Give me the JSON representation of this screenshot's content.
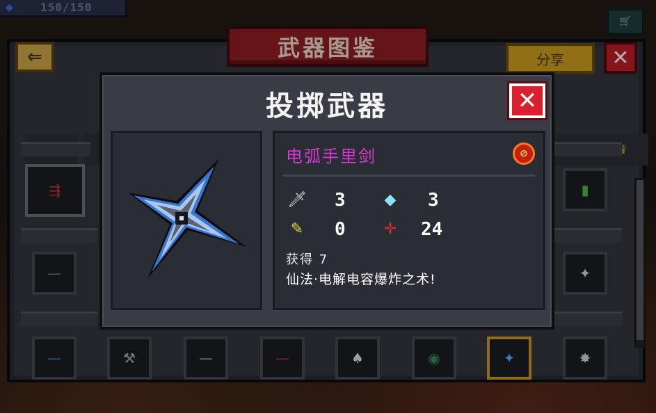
{
  "hud": {
    "energy_text": "150/150",
    "energy_icon": "diamond-icon",
    "cart_icon": "cart-icon"
  },
  "codex": {
    "title": "武器图鉴",
    "back_icon": "back-arrow-icon",
    "share_label": "分享",
    "close_icon": "close-icon"
  },
  "modal": {
    "title": "投掷武器",
    "close_icon": "close-icon",
    "weapon": {
      "name": "电弧手里剑",
      "name_color": "#d23ad2",
      "icon": "shuriken-icon",
      "unsellable_icon": "no-sell-icon",
      "stats": {
        "damage": "3",
        "energy_cost": "3",
        "crit": "0",
        "accuracy": "24"
      },
      "obtained_label": "获得",
      "obtained_count": "7",
      "description": "仙法·电解电容爆炸之术!"
    }
  },
  "colors": {
    "ribbon": "#8c1c22",
    "share_button": "#c99a1e",
    "close_button": "#d9202c",
    "selected_slot": "#c9962a"
  }
}
